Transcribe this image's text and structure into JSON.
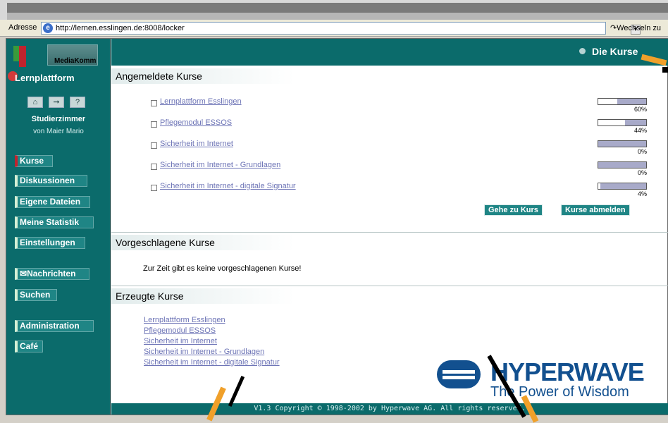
{
  "browser": {
    "address_label": "Adresse",
    "url": "http://lernen.esslingen.de:8008/locker",
    "go_label": "Wechseln zu"
  },
  "sidebar": {
    "logo_brand": "MediaKomm",
    "logo_title": "Lernplattform",
    "icons": [
      "home-icon",
      "logout-icon",
      "help-icon"
    ],
    "help_glyph": "?",
    "room_title": "Studierzimmer",
    "room_owner": "von Maier Mario",
    "nav": [
      {
        "label": "Kurse",
        "active": true
      },
      {
        "label": "Diskussionen"
      },
      {
        "label": "Eigene Dateien"
      },
      {
        "label": "Meine Statistik"
      },
      {
        "label": "Einstellungen"
      },
      {
        "label": "Nachrichten"
      },
      {
        "label": "Suchen"
      },
      {
        "label": "Administration"
      },
      {
        "label": "Café"
      }
    ]
  },
  "header": {
    "title": "Die Kurse"
  },
  "registered": {
    "heading": "Angemeldete Kurse",
    "courses": [
      {
        "name": "Lernplattform Esslingen",
        "percent_label": "60%",
        "progress": 0.6
      },
      {
        "name": "Pflegemodul ESSOS",
        "percent_label": "44%",
        "progress": 0.44
      },
      {
        "name": "Sicherheit im Internet",
        "percent_label": "0%",
        "progress": 1.0
      },
      {
        "name": "Sicherheit im Internet - Grundlagen",
        "percent_label": "0%",
        "progress": 1.0
      },
      {
        "name": "Sicherheit im Internet - digitale Signatur",
        "percent_label": "4%",
        "progress": 0.96
      }
    ],
    "btn_goto": "Gehe zu Kurs",
    "btn_unsubscribe": "Kurse abmelden"
  },
  "suggested": {
    "heading": "Vorgeschlagene Kurse",
    "note": "Zur Zeit gibt es keine vorgeschlagenen Kurse!"
  },
  "created": {
    "heading": "Erzeugte Kurse",
    "courses": [
      "Lernplattform Esslingen",
      "Pflegemodul ESSOS",
      "Sicherheit im Internet",
      "Sicherheit im Internet - Grundlagen",
      "Sicherheit im Internet - digitale Signatur"
    ]
  },
  "footer": {
    "copyright": "V1.3 Copyright © 1998-2002 by Hyperwave AG. All rights reserved."
  },
  "branding": {
    "word": "HYPERWAVE",
    "tagline": "The Power of Wisdom"
  },
  "colors": {
    "teal": "#0b6b6b",
    "link": "#6d74b6",
    "progress": "#a8aac9",
    "brand_blue": "#12508f"
  }
}
